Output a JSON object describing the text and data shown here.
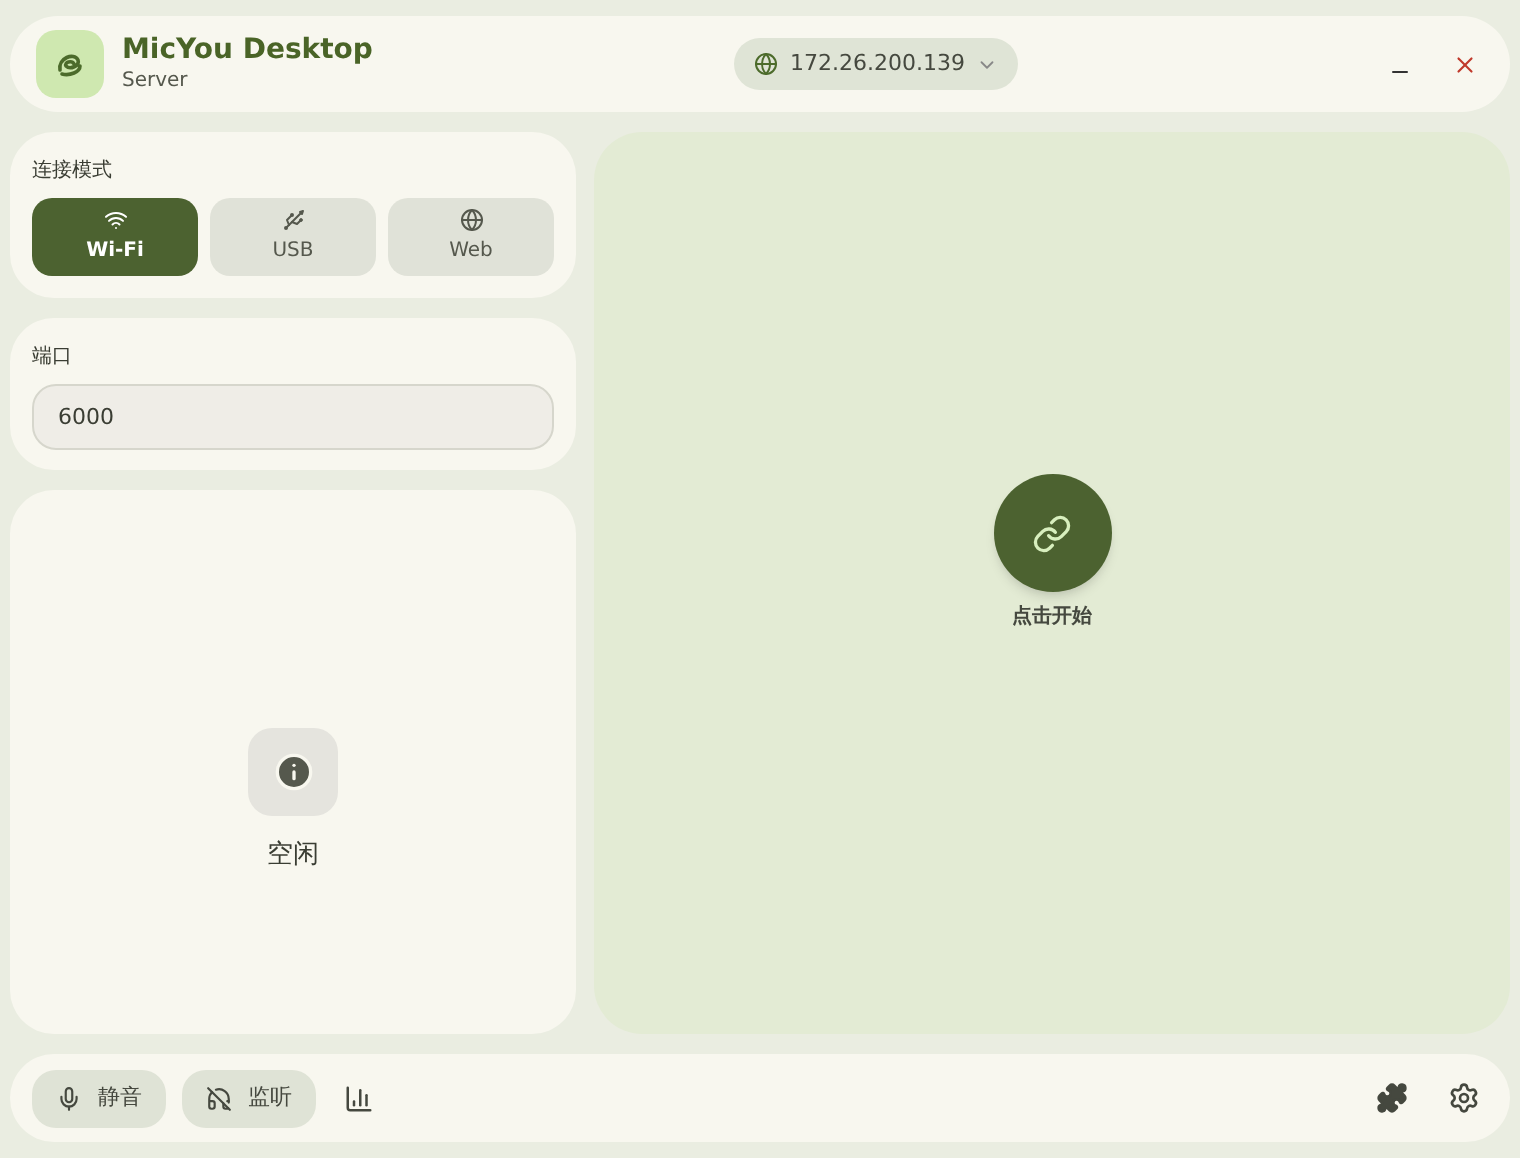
{
  "header": {
    "title": "MicYou Desktop",
    "subtitle": "Server",
    "address": "172.26.200.139"
  },
  "connection": {
    "label": "连接模式",
    "modes": [
      {
        "kind": "wifi",
        "label": "Wi-Fi",
        "selected": true
      },
      {
        "kind": "usb",
        "label": "USB",
        "selected": false
      },
      {
        "kind": "web",
        "label": "Web",
        "selected": false
      }
    ]
  },
  "port": {
    "label": "端口",
    "value": "6000"
  },
  "status": {
    "text": "空闲"
  },
  "start": {
    "label": "点击开始"
  },
  "bottom_bar": {
    "buttons": [
      {
        "kind": "mute",
        "label": "静音"
      },
      {
        "kind": "monitor",
        "label": "监听"
      }
    ]
  }
}
